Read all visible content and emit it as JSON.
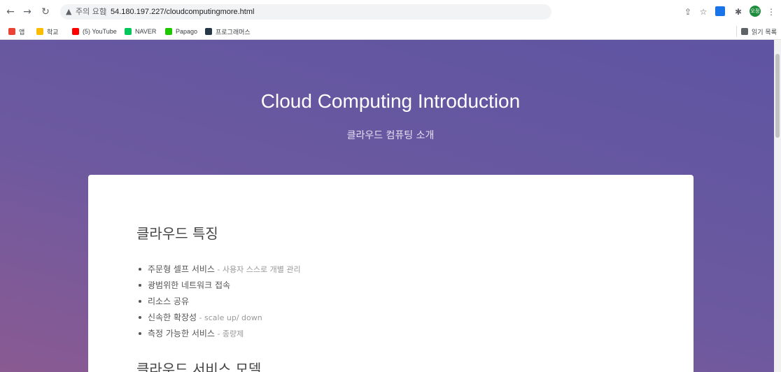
{
  "browser": {
    "address": {
      "warning_icon": "warning-triangle-icon",
      "warning_text": "주의 요함",
      "separator": "|",
      "url": "54.180.197.227/cloudcomputingmore.html"
    },
    "profile_initials": "오정"
  },
  "bookmarks": {
    "items": [
      {
        "label": "앱",
        "color": "#ea4335"
      },
      {
        "label": "학교",
        "color": "#fbbc04"
      },
      {
        "label": "(5) YouTube",
        "color": "#ff0000"
      },
      {
        "label": "NAVER",
        "color": "#03c75a"
      },
      {
        "label": "Papago",
        "color": "#1ec800"
      },
      {
        "label": "프로그래머스",
        "color": "#263747"
      }
    ],
    "reading_list": "읽기 목록"
  },
  "page": {
    "hero_title": "Cloud Computing Introduction",
    "hero_subtitle": "클라우드 컴퓨팅 소개",
    "section1_title": "클라우드 특징",
    "features": [
      {
        "main": "주문형 셀프 서비스",
        "note": " - 사용자 스스로 개별 관리"
      },
      {
        "main": "광범위한 네트워크 접속",
        "note": ""
      },
      {
        "main": "리소스 공유",
        "note": ""
      },
      {
        "main": "신속한 확장성",
        "note": " - scale up/ down"
      },
      {
        "main": "측정 가능한 서비스",
        "note": " - 종량제"
      }
    ],
    "section2_title": "클라우드 서비스 모델"
  }
}
